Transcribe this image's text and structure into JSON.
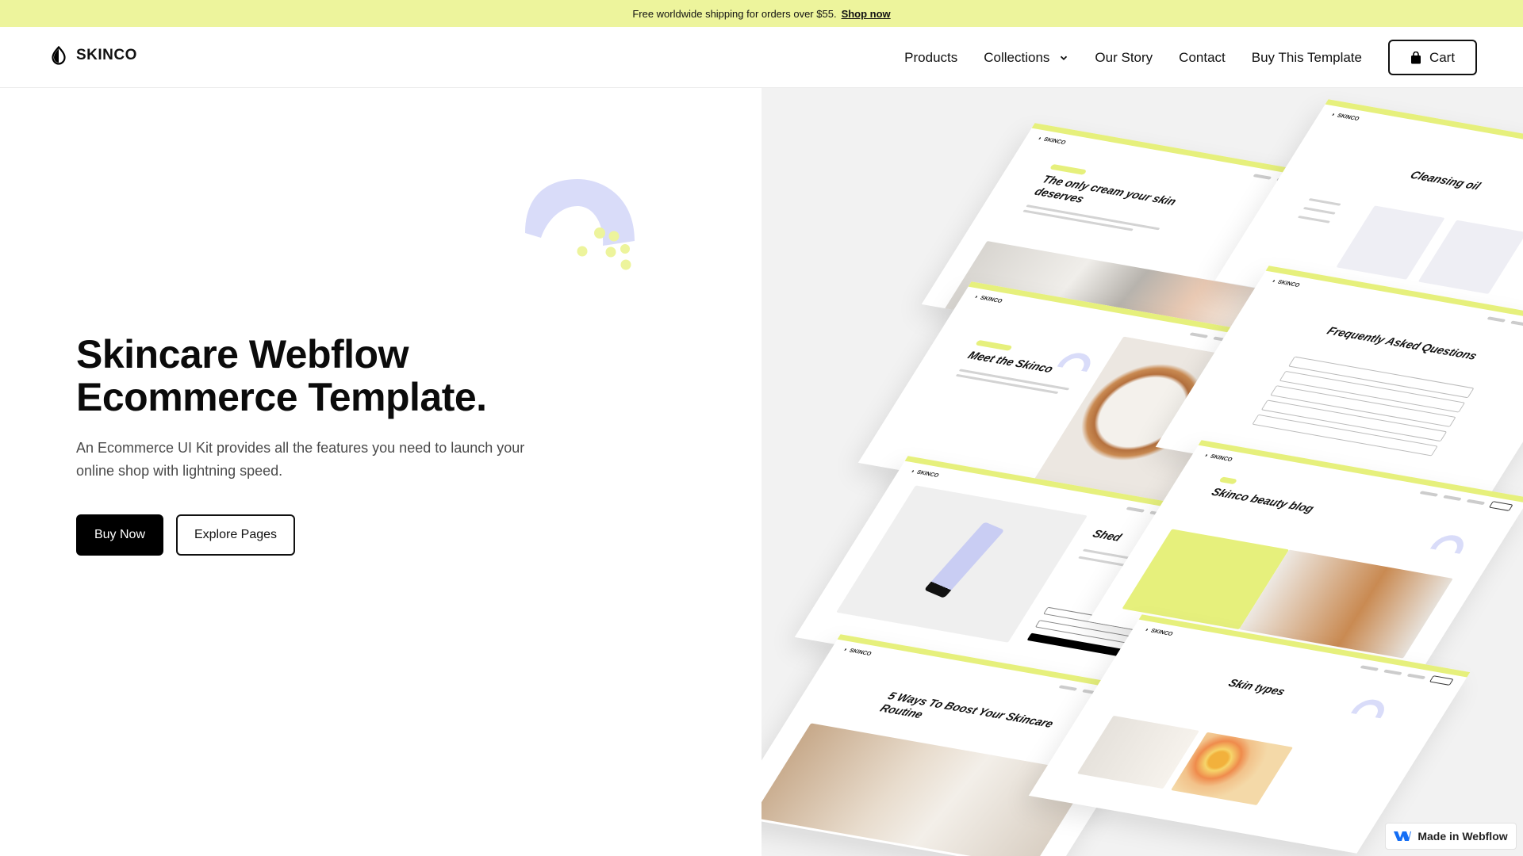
{
  "announcement": {
    "text": "Free worldwide shipping for orders over $55.",
    "link": "Shop now"
  },
  "header": {
    "brand": "SKINCO",
    "nav": [
      "Products",
      "Collections",
      "Our Story",
      "Contact",
      "Buy This Template"
    ],
    "cart_label": "Cart"
  },
  "hero": {
    "title": "Skincare Webflow Ecommerce Template.",
    "subtitle": "An Ecommerce UI Kit provides all the features you need to launch your online shop with lightning speed.",
    "primary_button": "Buy Now",
    "secondary_button": "Explore Pages"
  },
  "collage": {
    "pages": [
      {
        "title": "The only cream your skin deserves"
      },
      {
        "title": "Cleansing oil"
      },
      {
        "title": "Meet the Skinco"
      },
      {
        "title": "Frequently Asked Questions"
      },
      {
        "title": "Shed"
      },
      {
        "title": "Skinco beauty blog"
      },
      {
        "title": "5 Ways To Boost Your Skincare Routine"
      },
      {
        "title": "Skin types"
      }
    ]
  },
  "badge": {
    "label": "Made in Webflow"
  },
  "colors": {
    "accent_yellow": "#edf49c",
    "lavender": "#d9dcf9",
    "black": "#000000"
  },
  "icons": {
    "logo": "drop-half-icon",
    "collections_dropdown": "chevron-down-icon",
    "cart": "shopping-bag-icon",
    "badge": "webflow-logo-icon"
  }
}
